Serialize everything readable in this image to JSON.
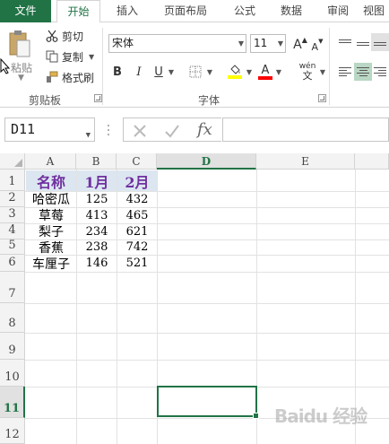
{
  "tabs": [
    {
      "label": "文件"
    },
    {
      "label": "开始"
    },
    {
      "label": "插入"
    },
    {
      "label": "页面布局"
    },
    {
      "label": "公式"
    },
    {
      "label": "数据"
    },
    {
      "label": "审阅"
    },
    {
      "label": "视图"
    }
  ],
  "clipboard": {
    "paste_label": "粘贴",
    "cut_label": "剪切",
    "copy_label": "复制",
    "format_painter_label": "格式刷",
    "group_label": "剪贴板"
  },
  "font": {
    "family": "宋体",
    "size": "11",
    "bold": "B",
    "italic": "I",
    "underline": "U",
    "grow": "A",
    "shrink": "A",
    "phonetic": "wén",
    "group_label": "字体",
    "fill_color": "#FFFF00",
    "font_color": "#FF0000"
  },
  "formula_bar": {
    "name_box": "D11",
    "fx_label": "fx",
    "formula": ""
  },
  "columns": [
    "A",
    "B",
    "C",
    "D",
    "E"
  ],
  "rows": [
    "1",
    "2",
    "3",
    "4",
    "5",
    "6",
    "7",
    "8",
    "9",
    "10",
    "11",
    "12"
  ],
  "selected_cell": {
    "column": "D",
    "row": "11"
  },
  "sheet": {
    "header": [
      "名称",
      "1月",
      "2月"
    ],
    "data": [
      [
        "哈密瓜",
        "125",
        "432"
      ],
      [
        "草莓",
        "413",
        "465"
      ],
      [
        "梨子",
        "234",
        "621"
      ],
      [
        "香蕉",
        "238",
        "742"
      ],
      [
        "车厘子",
        "146",
        "521"
      ]
    ]
  },
  "watermark": "Baidu 经验",
  "colors": {
    "accent": "#217346",
    "header_text": "#7030A0",
    "header_fill": "#DCE6F1"
  }
}
